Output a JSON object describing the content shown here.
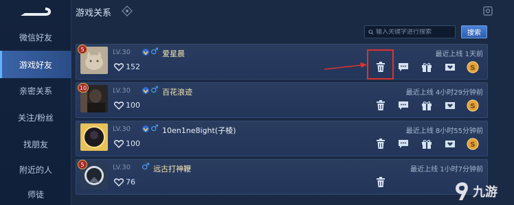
{
  "header": {
    "title": "游戏关系"
  },
  "sidebar": {
    "items": [
      {
        "label": "微信好友",
        "active": false
      },
      {
        "label": "游戏好友",
        "active": true
      },
      {
        "label": "亲密关系",
        "active": false
      },
      {
        "label": "关注/粉丝",
        "active": false
      },
      {
        "label": "找朋友",
        "active": false
      },
      {
        "label": "附近的人",
        "active": false
      },
      {
        "label": "师徒",
        "active": false
      }
    ]
  },
  "search": {
    "placeholder": "输入关键字进行搜索",
    "button_label": "搜索"
  },
  "friends": [
    {
      "rank": "5",
      "level": "LV.30",
      "name": "爱星晨",
      "intimacy": "152",
      "last_online": "最近上线  1天前"
    },
    {
      "rank": "10",
      "level": "LV.30",
      "name": "百花浪迹",
      "intimacy": "100",
      "last_online": "最近上线  4小时29分钟前"
    },
    {
      "rank": "",
      "level": "LV.30",
      "name": "10en1ne8ight(子棱)",
      "intimacy": "100",
      "last_online": "最近上线  8小时55分钟前"
    },
    {
      "rank": "5",
      "level": "LV.30",
      "name": "远古打神鞭",
      "intimacy": "76",
      "last_online": "最近上线  1小时7分钟前"
    }
  ],
  "watermark": {
    "text": "九游"
  },
  "colors": {
    "background": "#1b2a44",
    "sidebar_active": "#3a64a8",
    "name_gold": "#f5e6b4",
    "highlight_red": "#e0322e",
    "gender_blue": "#4aa3ff"
  }
}
